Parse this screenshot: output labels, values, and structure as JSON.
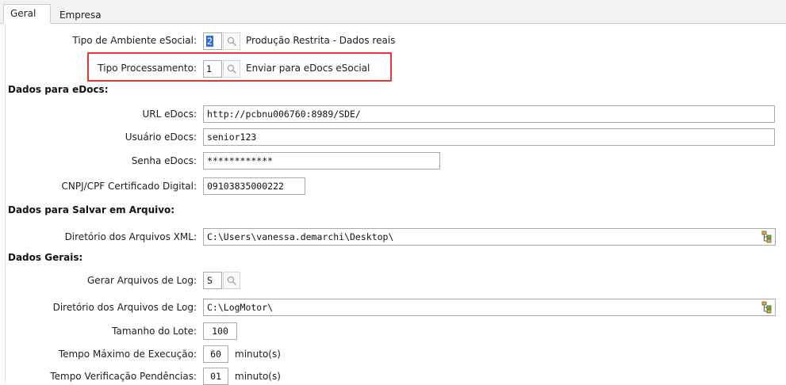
{
  "tabs": [
    {
      "label": "Geral",
      "active": true
    },
    {
      "label": "Empresa",
      "active": false
    }
  ],
  "tipo_ambiente": {
    "label": "Tipo de Ambiente eSocial:",
    "value": "2",
    "description": "Produção Restrita - Dados reais"
  },
  "tipo_processamento": {
    "label": "Tipo Processamento:",
    "value": "1",
    "description": "Enviar para eDocs eSocial"
  },
  "section_edocs": "Dados para eDocs:",
  "url_edocs": {
    "label": "URL eDocs:",
    "value": "http://pcbnu006760:8989/SDE/"
  },
  "usuario_edocs": {
    "label": "Usuário eDocs:",
    "value": "senior123"
  },
  "senha_edocs": {
    "label": "Senha eDocs:",
    "value": "************"
  },
  "cnpj": {
    "label": "CNPJ/CPF Certificado Digital:",
    "value": "09103835000222"
  },
  "section_arquivo": "Dados para Salvar em Arquivo:",
  "dir_xml": {
    "label": "Diretório dos Arquivos XML:",
    "value": "C:\\Users\\vanessa.demarchi\\Desktop\\"
  },
  "section_gerais": "Dados Gerais:",
  "gerar_log": {
    "label": "Gerar Arquivos de Log:",
    "value": "S"
  },
  "dir_log": {
    "label": "Diretório dos Arquivos de Log:",
    "value": "C:\\LogMotor\\"
  },
  "tamanho_lote": {
    "label": "Tamanho do Lote:",
    "value": "100"
  },
  "tempo_maximo": {
    "label": "Tempo Máximo de Execução:",
    "value": "60",
    "unit": "minuto(s)"
  },
  "tempo_verificacao": {
    "label": "Tempo Verificação Pendências:",
    "value": "01",
    "unit": "minuto(s)"
  },
  "colors": {
    "highlight": "#e53535",
    "selection": "#2f6fd6"
  }
}
